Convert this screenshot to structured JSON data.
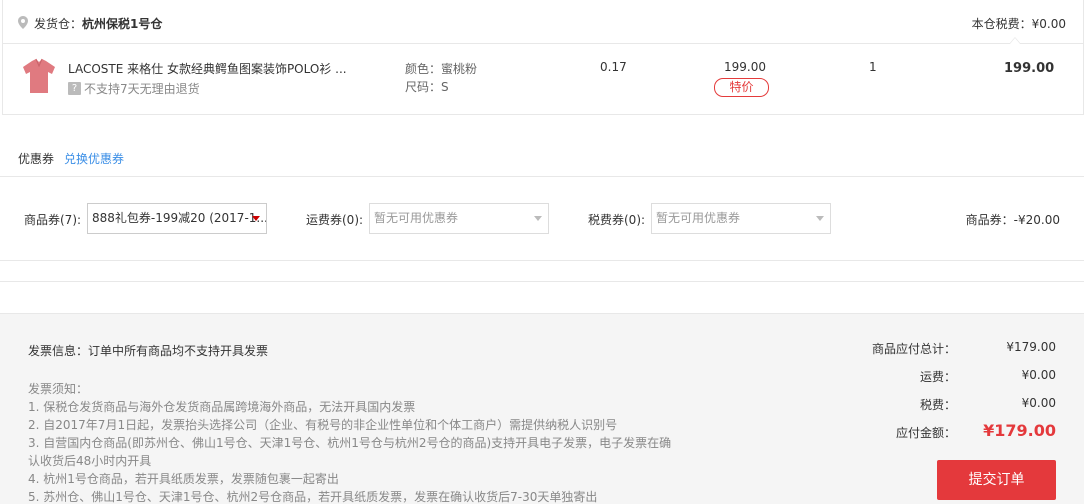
{
  "warehouse": {
    "label": "发货仓：",
    "name": "杭州保税1号仓",
    "tax_label": "本仓税费：¥0.00"
  },
  "product": {
    "name": "LACOSTE 来格仕 女款经典鳄鱼图案装饰POLO衫 ...",
    "no_return": "不支持7天无理由退货",
    "color": "颜色：蜜桃粉",
    "size": "尺码：S",
    "weight": "0.17",
    "price": "199.00",
    "badge": "特价",
    "quantity": "1",
    "subtotal": "199.00",
    "thumb_color": "#e07a80"
  },
  "coupon": {
    "title": "优惠券",
    "exchange_link": "兑换优惠券",
    "goods_label": "商品券(7):",
    "goods_value": "888礼包券-199减20 (2017-1...",
    "shipping_label": "运费券(0):",
    "shipping_placeholder": "暂无可用优惠券",
    "tax_label": "税费券(0):",
    "tax_placeholder": "暂无可用优惠券",
    "discount": "商品券：-¥20.00"
  },
  "invoice": {
    "info": "发票信息：订单中所有商品均不支持开具发票",
    "notes_title": "发票须知：",
    "notes": [
      "1. 保税仓发货商品与海外仓发货商品属跨境海外商品，无法开具国内发票",
      "2. 自2017年7月1日起，发票抬头选择公司（企业、有税号的非企业性单位和个体工商户）需提供纳税人识别号",
      "3. 自营国内仓商品(即苏州仓、佛山1号仓、天津1号仓、杭州1号仓与杭州2号仓的商品)支持开具电子发票，电子发票在确认收货后48小时内开具",
      "4. 杭州1号仓商品，若开具纸质发票，发票随包裹一起寄出",
      "5. 苏州仓、佛山1号仓、天津1号仓、杭州2号仓商品，若开具纸质发票，发票在确认收货后7-30天单独寄出"
    ]
  },
  "summary": {
    "goods_total_label": "商品应付总计：",
    "goods_total": "¥179.00",
    "shipping_label": "运费：",
    "shipping": "¥0.00",
    "tax_label": "税费：",
    "tax": "¥0.00",
    "payable_label": "应付金额：",
    "payable": "¥179.00"
  },
  "submit_label": "提交订单",
  "colors": {
    "accent": "#e4393c",
    "link": "#3a8ee6"
  }
}
